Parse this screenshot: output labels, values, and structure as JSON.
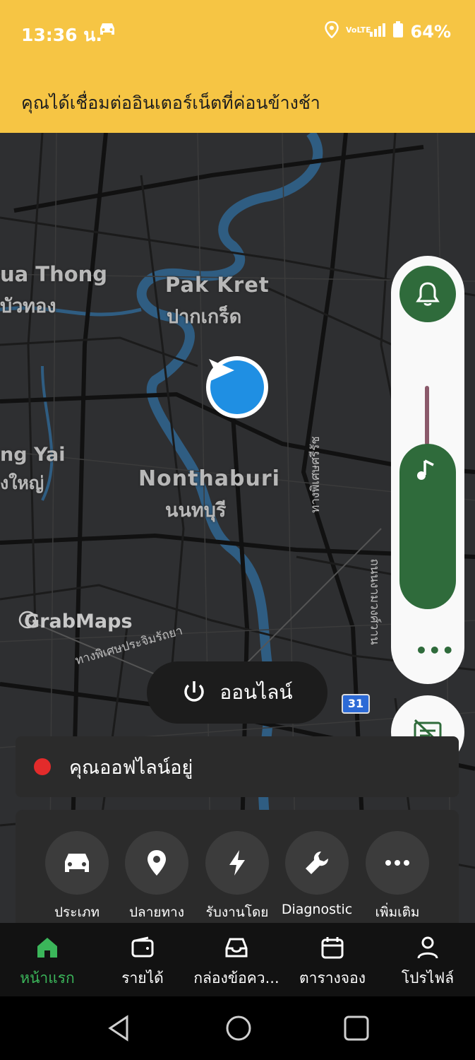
{
  "status": {
    "time": "13:36 น.",
    "battery": "64%"
  },
  "banner": {
    "message": "คุณได้เชื่อมต่ออินเตอร์เน็ตที่ค่อนข้างช้า"
  },
  "map": {
    "places": [
      {
        "en": "Pak Kret",
        "th": "ปากเกร็ด"
      },
      {
        "en": "Nonthaburi",
        "th": "นนทบุรี"
      },
      {
        "en": "ua Thong",
        "th": "บัวทอง"
      },
      {
        "en": "ng Yai",
        "th": "งใหญ่"
      }
    ],
    "roads": [
      "ทางพิเศษประจิมรัถยา",
      "ทางพิเศษศรีรัช",
      "ถนนงามวงศ์วาน"
    ],
    "route_shield": "31",
    "attribution": "GrabMaps"
  },
  "online_button": {
    "label": "ออนไลน์"
  },
  "offline_status": {
    "text": "คุณออฟไลน์อยู่"
  },
  "shortcuts": [
    {
      "label": "ประเภท",
      "icon": "car-icon"
    },
    {
      "label": "ปลายทาง",
      "icon": "location-pin-icon"
    },
    {
      "label": "รับงานโดย",
      "icon": "lightning-icon"
    },
    {
      "label": "Diagnostic",
      "icon": "wrench-icon"
    },
    {
      "label": "เพิ่มเติม",
      "icon": "more-icon"
    }
  ],
  "tabs": [
    {
      "label": "หน้าแรก",
      "icon": "home-icon",
      "active": true
    },
    {
      "label": "รายได้",
      "icon": "wallet-icon",
      "active": false
    },
    {
      "label": "กล่องข้อคว...",
      "icon": "inbox-icon",
      "active": false
    },
    {
      "label": "ตารางจอง",
      "icon": "calendar-icon",
      "active": false
    },
    {
      "label": "โปรไฟล์",
      "icon": "profile-icon",
      "active": false
    }
  ],
  "colors": {
    "accent_green": "#2f6b3b",
    "banner_yellow": "#f6c544",
    "active_tab": "#3bb65a",
    "offline_red": "#e32b2b"
  }
}
